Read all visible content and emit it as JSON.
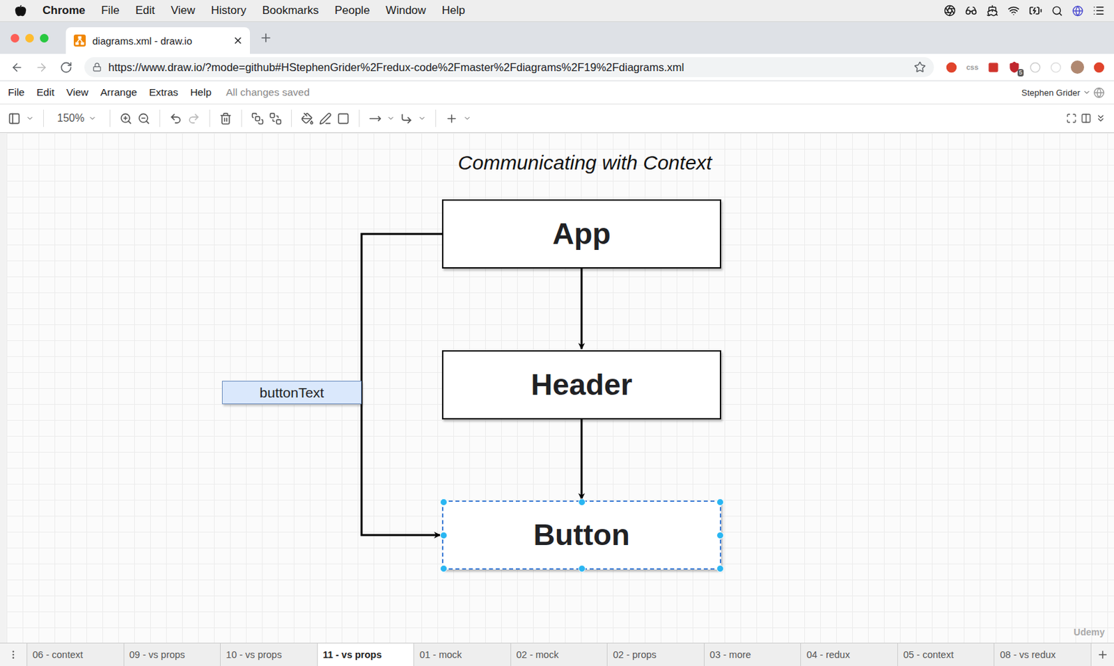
{
  "menubar": {
    "app": "Chrome",
    "items": [
      "File",
      "Edit",
      "View",
      "History",
      "Bookmarks",
      "People",
      "Window",
      "Help"
    ]
  },
  "browser": {
    "tab_title": "diagrams.xml - draw.io",
    "url": "https://www.draw.io/?mode=github#HStephenGrider%2Fredux-code%2Fmaster%2Fdiagrams%2F19%2Fdiagrams.xml",
    "css_extension": "css",
    "extension_badge": "5"
  },
  "app_menu": {
    "items": [
      "File",
      "Edit",
      "View",
      "Arrange",
      "Extras",
      "Help"
    ],
    "status": "All changes saved",
    "user": "Stephen Grider"
  },
  "toolbar": {
    "zoom": "150%"
  },
  "diagram": {
    "title": "Communicating with Context",
    "nodes": [
      {
        "label": "App",
        "selected": false
      },
      {
        "label": "Header",
        "selected": false
      },
      {
        "label": "Button",
        "selected": true
      }
    ],
    "data_label": "buttonText"
  },
  "pages": [
    {
      "label": "06 - context",
      "selected": false
    },
    {
      "label": "09 - vs props",
      "selected": false
    },
    {
      "label": "10 - vs props",
      "selected": false
    },
    {
      "label": "11 - vs props",
      "selected": true
    },
    {
      "label": "01 - mock",
      "selected": false
    },
    {
      "label": "02 - mock",
      "selected": false
    },
    {
      "label": "02 - props",
      "selected": false
    },
    {
      "label": "03 - more",
      "selected": false
    },
    {
      "label": "04 - redux",
      "selected": false
    },
    {
      "label": "05 - context",
      "selected": false
    },
    {
      "label": "08 - vs redux",
      "selected": false
    }
  ],
  "watermark": "Udemy"
}
